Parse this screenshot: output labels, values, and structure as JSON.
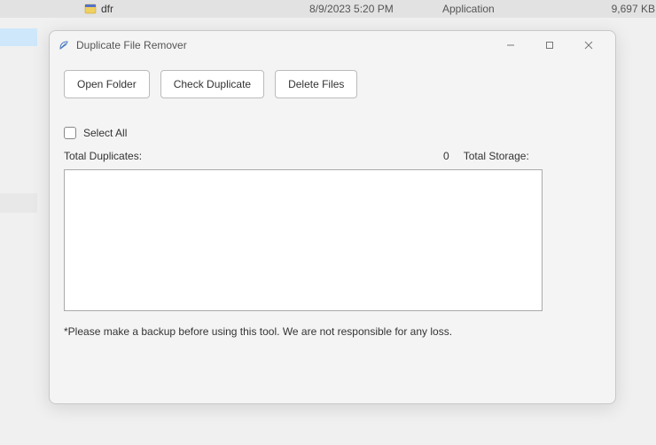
{
  "explorer": {
    "file_name": "dfr",
    "date": "8/9/2023 5:20 PM",
    "type": "Application",
    "size": "9,697 KB"
  },
  "window": {
    "title": "Duplicate File Remover"
  },
  "buttons": {
    "open_folder": "Open Folder",
    "check_duplicate": "Check Duplicate",
    "delete_files": "Delete Files"
  },
  "select_all": {
    "label": "Select All"
  },
  "stats": {
    "duplicates_label": "Total Duplicates:",
    "duplicates_value": "0",
    "storage_label": "Total Storage:"
  },
  "disclaimer": "*Please make a backup before using this tool. We are not responsible for any loss."
}
